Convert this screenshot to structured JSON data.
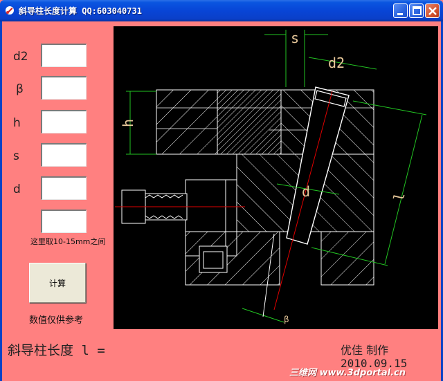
{
  "window": {
    "title": "斜导柱长度计算  QQ:603040731",
    "icon": "app-icon",
    "controls": [
      "minimize-icon",
      "maximize-icon",
      "close-icon"
    ]
  },
  "inputs": [
    {
      "label": "d2",
      "value": ""
    },
    {
      "label": "β",
      "value": ""
    },
    {
      "label": "h",
      "value": ""
    },
    {
      "label": "s",
      "value": ""
    },
    {
      "label": "d",
      "value": ""
    },
    {
      "label": "",
      "value": ""
    }
  ],
  "hint": "这里取10-15mm之间",
  "calc_button": "计算",
  "note": "数值仅供参考",
  "result_label": "斜导柱长度 l =",
  "author": "优佳 制作",
  "date": "2010.09.15",
  "watermark": "三维网 www.3dportal.cn",
  "drawing": {
    "labels": {
      "s": "s",
      "d2": "d2",
      "h": "h",
      "d": "d",
      "l": "l",
      "beta": "β"
    }
  },
  "colors": {
    "background": "#ff8080",
    "titlebar": "#0845d6",
    "drawing_bg": "#000000",
    "line_white": "#ffffff",
    "dimension_green": "#22c322",
    "centerline_red": "#e00000",
    "label_tan": "#e8c89a"
  }
}
